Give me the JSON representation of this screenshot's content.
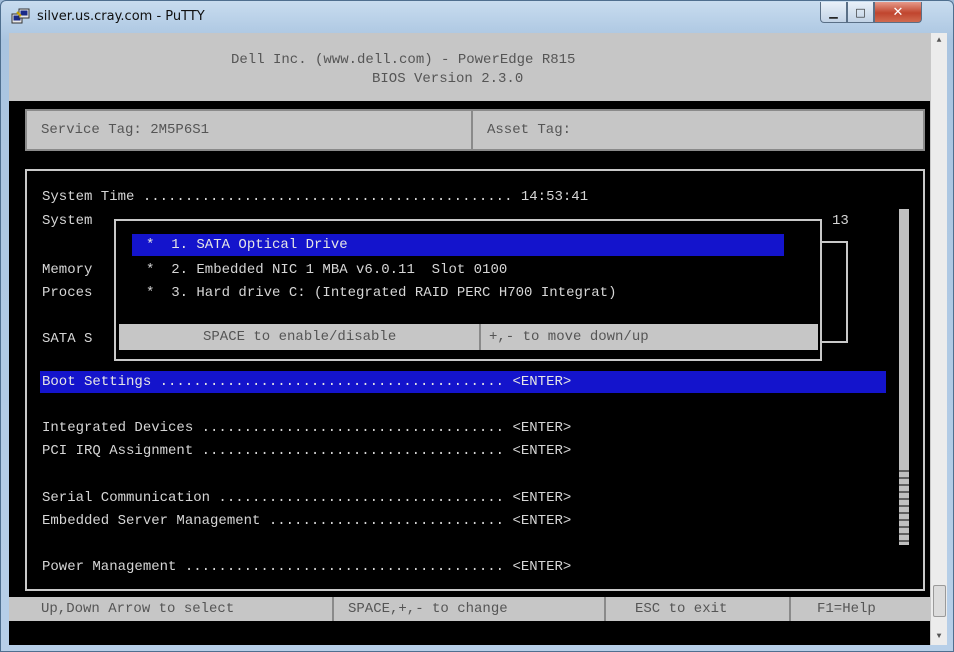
{
  "window": {
    "title": "silver.us.cray.com - PuTTY"
  },
  "bios": {
    "header_line1": "Dell Inc. (www.dell.com) - PowerEdge R815",
    "header_line2": "BIOS Version 2.3.0",
    "service_tag": "Service Tag: 2M5P6S1",
    "asset_tag": "Asset Tag:",
    "menu": {
      "system_time": "System Time ............................................ 14:53:41",
      "system_partial": "System",
      "system_value_fragment": "13",
      "memory_partial": "Memory",
      "processor_partial": "Proces",
      "sata_partial": "SATA S",
      "boot_settings": "Boot Settings ......................................... <ENTER>",
      "integrated_devices": "Integrated Devices .................................... <ENTER>",
      "pci_irq": "PCI IRQ Assignment .................................... <ENTER>",
      "serial_comm": "Serial Communication .................................. <ENTER>",
      "embedded_mgmt": "Embedded Server Management ............................ <ENTER>",
      "power_mgmt": "Power Management ...................................... <ENTER>"
    },
    "boot_sequence": {
      "items": [
        "*  1. SATA Optical Drive",
        "*  2. Embedded NIC 1 MBA v6.0.11  Slot 0100",
        "*  3. Hard drive C: (Integrated RAID PERC H700 Integrat)"
      ],
      "hint_toggle": "SPACE to enable/disable",
      "hint_move": "+,- to move down/up"
    },
    "footer": {
      "select": "Up,Down Arrow to select",
      "change": "SPACE,+,- to change",
      "exit": "ESC to exit",
      "help": "F1=Help"
    }
  },
  "icons": {
    "app": "putty-icon",
    "minimize": "minimize-icon",
    "maximize": "maximize-icon",
    "close": "close-icon"
  },
  "colors": {
    "highlight": "#1414cc",
    "terminal_bg": "#000000",
    "panel_gray": "#c6c6c6"
  }
}
